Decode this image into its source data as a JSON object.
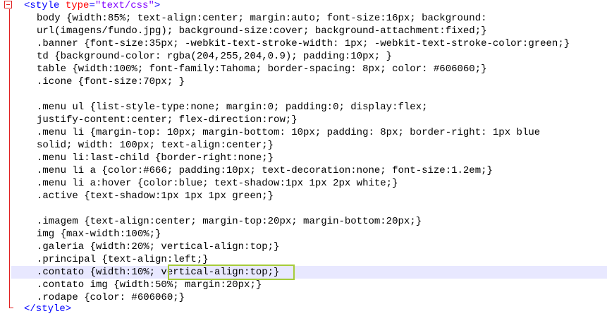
{
  "editor": {
    "open_tag": "<style",
    "type_attr": "type",
    "type_eq": "=",
    "type_value": "\"text/css\"",
    "open_tag_end": ">",
    "close_tag": "</style>",
    "lines": [
      "body {width:85%; text-align:center; margin:auto; font-size:16px; background:",
      "url(imagens/fundo.jpg); background-size:cover; background-attachment:fixed;}",
      ".banner {font-size:35px; -webkit-text-stroke-width: 1px; -webkit-text-stroke-color:green;}",
      "td {background-color: rgba(204,255,204,0.9); padding:10px; }",
      "table {width:100%; font-family:Tahoma; border-spacing: 8px; color: #606060;}",
      ".icone {font-size:70px; }",
      "",
      ".menu ul {list-style-type:none; margin:0; padding:0; display:flex;",
      "justify-content:center; flex-direction:row;}",
      ".menu li {margin-top: 10px; margin-bottom: 10px; padding: 8px; border-right: 1px blue",
      "solid; width: 100px; text-align:center;}",
      ".menu li:last-child {border-right:none;}",
      ".menu li a {color:#666; padding:10px; text-decoration:none; font-size:1.2em;}",
      ".menu li a:hover {color:blue; text-shadow:1px 1px 2px white;}",
      ".active {text-shadow:1px 1px 1px green;}",
      "",
      ".imagem {text-align:center; margin-top:20px; margin-bottom:20px;}",
      "img {max-width:100%;}",
      ".galeria {width:20%; vertical-align:top;}",
      ".principal {text-align:left;}",
      ".contato {width:10%; vertical-align:top;}",
      ".contato img {width:50%; margin:20px;}",
      ".rodape {color: #606060;}"
    ],
    "current_line_index": 20,
    "highlighted_text": "vertical-align:top;"
  }
}
